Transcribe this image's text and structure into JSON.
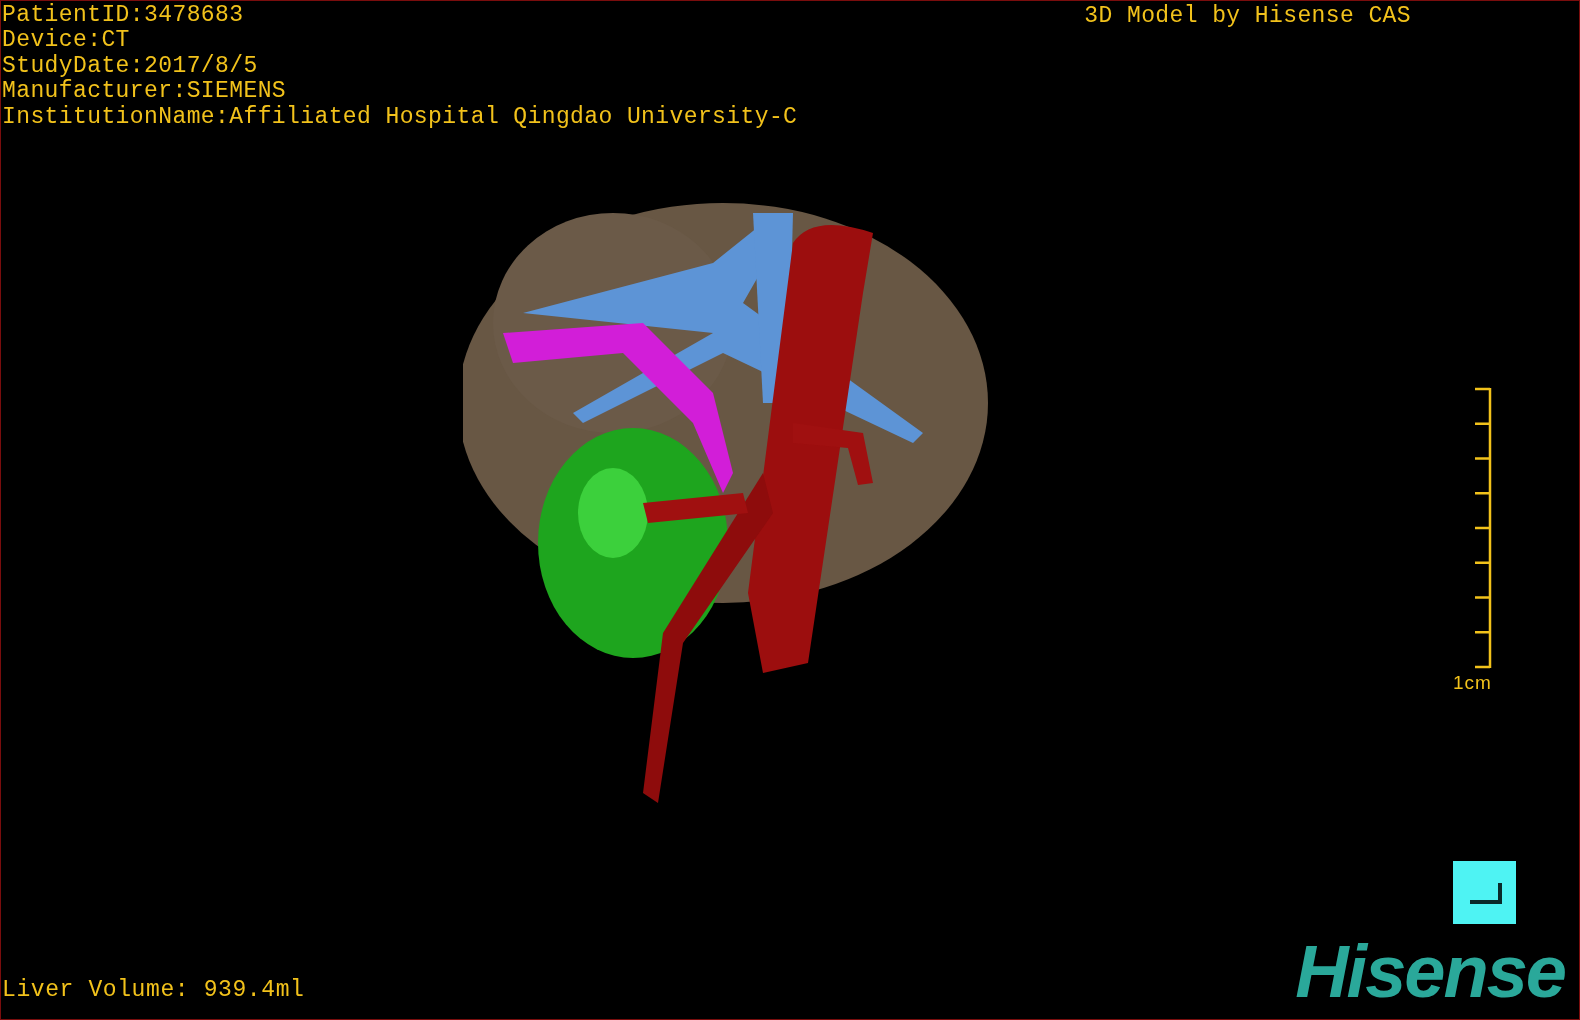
{
  "viewer": {
    "info_lines": [
      "PatientID:3478683",
      "Device:CT",
      "StudyDate:2017/8/5",
      "Manufacturer:SIEMENS",
      "InstitutionName:Affiliated Hospital Qingdao University-C"
    ],
    "caption": "3D Model by Hisense CAS",
    "scale_bar": {
      "label": "1cm"
    },
    "measurement": "Liver Volume: 939.4ml",
    "logo": "Hisense"
  }
}
